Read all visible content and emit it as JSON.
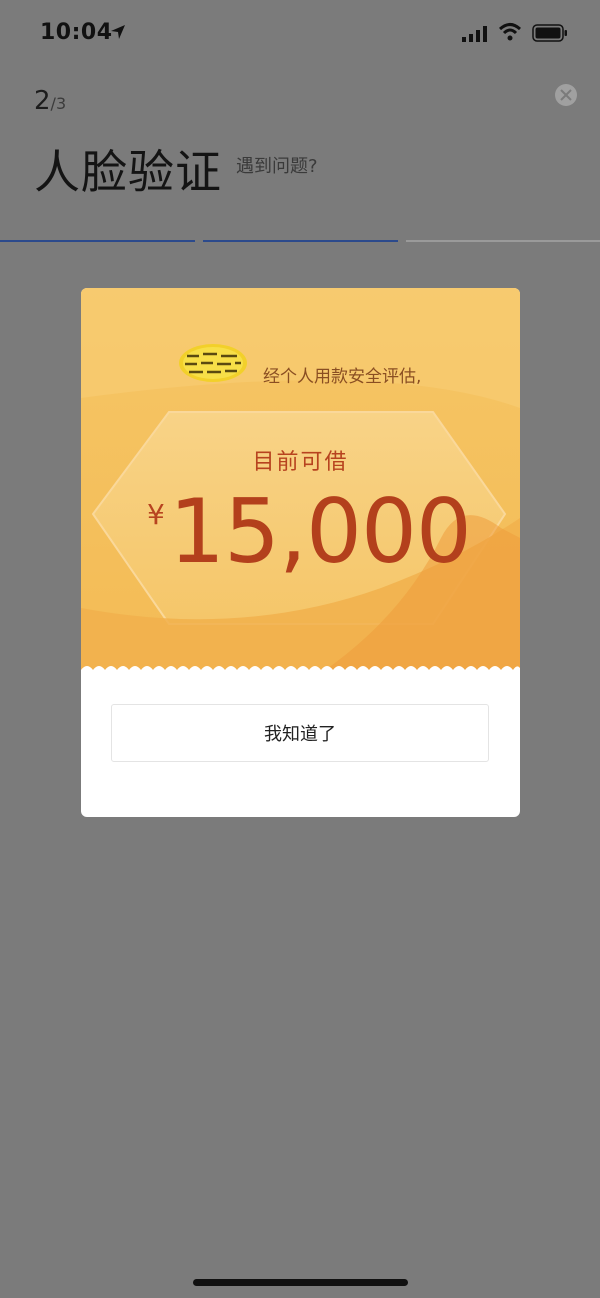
{
  "status_bar": {
    "time": "10:04",
    "icons": [
      "location-arrow-icon",
      "cellular-signal-icon",
      "wifi-icon",
      "battery-icon"
    ]
  },
  "header": {
    "step_current": "2",
    "step_total": "/3",
    "title": "人脸验证",
    "help_link": "遇到问题?",
    "close_icon": "close-circle-icon"
  },
  "progress": {
    "total_steps": 3,
    "completed_steps": 2,
    "active_color": "#2c4a8c"
  },
  "dialog": {
    "badge_icon": "badge-icon",
    "subtitle": "经个人用款安全评估,",
    "amount_label": "目前可借",
    "currency_symbol": "¥",
    "amount": "15,000",
    "ok_button": "我知道了",
    "colors": {
      "card": "#f6c562",
      "amount": "#b3401c"
    }
  }
}
